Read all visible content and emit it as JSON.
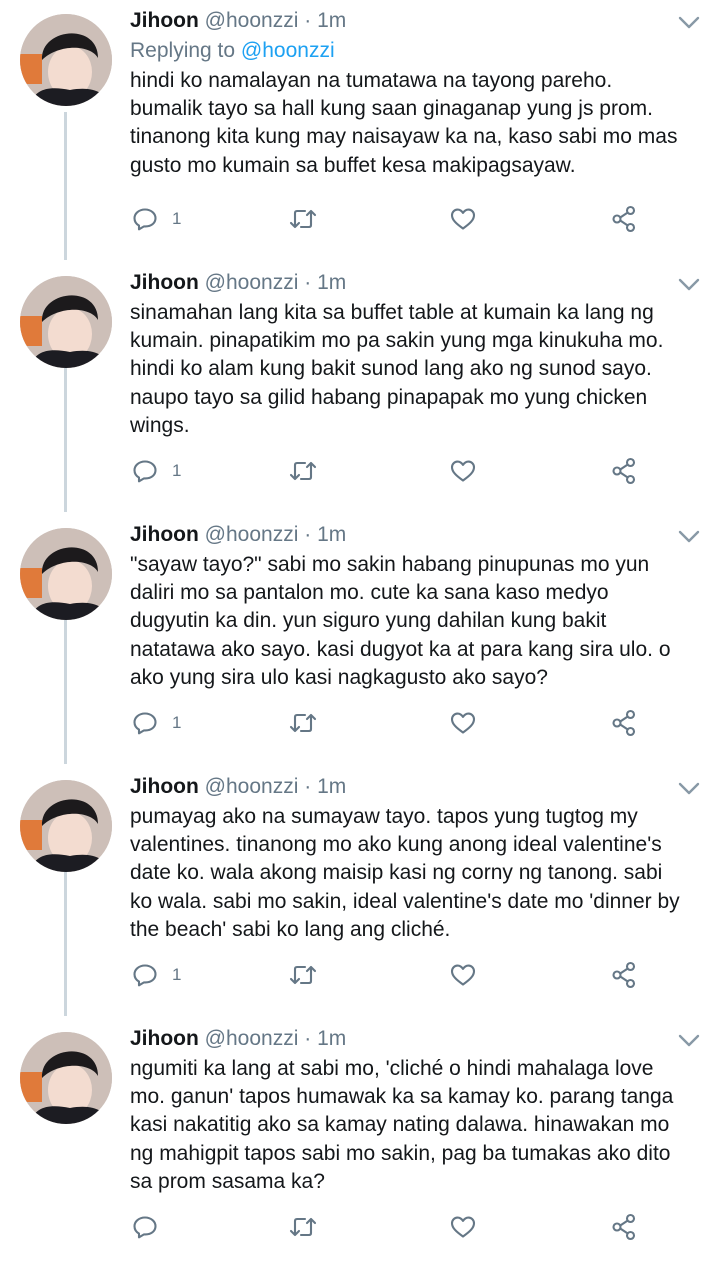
{
  "tweets": [
    {
      "name": "Jihoon",
      "handle": "@hoonzzi",
      "dot": "·",
      "time": "1m",
      "replying_prefix": "Replying to",
      "replying_to": "@hoonzzi",
      "text": "hindi ko namalayan na tumatawa na tayong pareho.\nbumalik tayo sa hall kung saan ginaganap yung js prom.\ntinanong kita kung may naisayaw ka na, kaso sabi mo mas\ngusto mo kumain sa buffet kesa makipagsayaw.",
      "replies": "1"
    },
    {
      "name": "Jihoon",
      "handle": "@hoonzzi",
      "dot": "·",
      "time": "1m",
      "text": "sinamahan lang kita sa buffet table at kumain ka lang ng\nkumain. pinapatikim mo pa sakin yung mga kinukuha mo.\nhindi ko alam kung bakit sunod lang ako ng sunod sayo.\nnaupo tayo sa gilid habang pinapapak mo yung chicken\nwings.",
      "replies": "1"
    },
    {
      "name": "Jihoon",
      "handle": "@hoonzzi",
      "dot": "·",
      "time": "1m",
      "text": "\"sayaw tayo?\" sabi mo sakin habang pinupunas mo yun\ndaliri mo sa pantalon mo. cute ka sana kaso medyo\ndugyutin ka din. yun siguro yung dahilan kung bakit\nnatatawa ako sayo. kasi dugyot ka at para kang sira ulo. o\nako yung sira ulo kasi nagkagusto ako sayo?",
      "replies": "1"
    },
    {
      "name": "Jihoon",
      "handle": "@hoonzzi",
      "dot": "·",
      "time": "1m",
      "text": "pumayag ako na sumayaw tayo. tapos yung tugtog my\nvalentines. tinanong mo ako kung anong ideal valentine's\ndate ko. wala akong maisip kasi ng corny ng tanong. sabi\nko wala. sabi mo sakin, ideal valentine's date mo 'dinner by\nthe beach' sabi ko lang ang cliché.",
      "replies": "1"
    },
    {
      "name": "Jihoon",
      "handle": "@hoonzzi",
      "dot": "·",
      "time": "1m",
      "text": "ngumiti ka lang at sabi mo, 'cliché o hindi mahalaga love\nmo. ganun' tapos humawak ka sa kamay ko. parang tanga\nkasi nakatitig ako sa kamay nating dalawa. hinawakan mo\nng mahigpit tapos sabi mo sakin, pag ba tumakas ako dito\nsa prom sasama ka?",
      "replies": ""
    }
  ],
  "icons": {
    "reply": "reply-icon",
    "retweet": "retweet-icon",
    "like": "like-icon",
    "share": "share-icon",
    "more": "chevron-down-icon"
  },
  "colors": {
    "text": "#14171a",
    "secondary": "#657786",
    "link": "#1da1f2",
    "thread_line": "#ccd6dd"
  }
}
